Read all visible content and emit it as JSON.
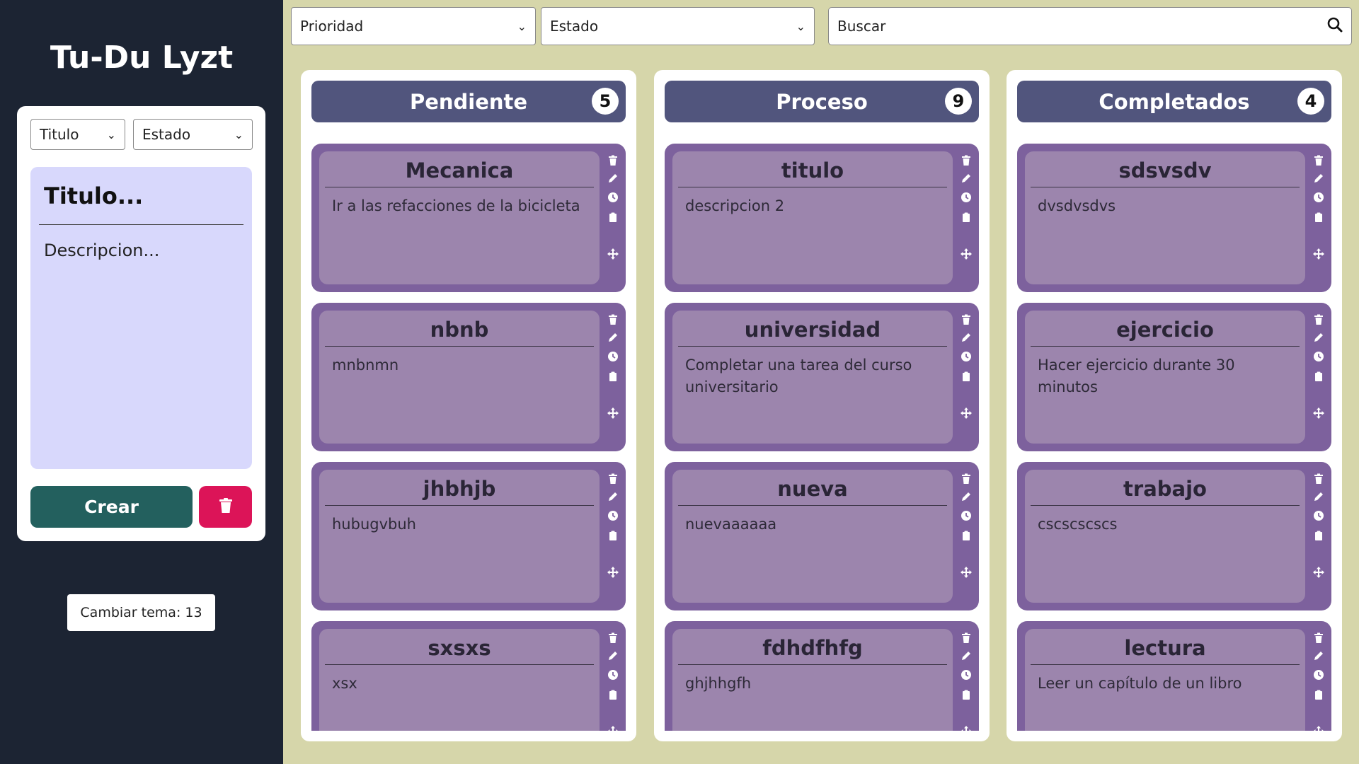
{
  "sidebar": {
    "app_title": "Tu-Du Lyzt",
    "create_form": {
      "title_select": "Titulo",
      "status_select": "Estado",
      "note_title_placeholder": "Titulo...",
      "note_desc_placeholder": "Descripcion...",
      "create_label": "Crear",
      "delete_icon": "trash-icon"
    },
    "theme_button": "Cambiar tema: 13"
  },
  "toolbar": {
    "priority_select": "Prioridad",
    "status_select": "Estado",
    "search_placeholder": "Buscar",
    "search_icon": "search-icon"
  },
  "card_action_icons": [
    "trash-icon",
    "pencil-icon",
    "clock-icon",
    "clipboard-icon",
    "move-icon"
  ],
  "colors": {
    "sidebar_bg": "#1c2433",
    "page_bg": "#d6d6aa",
    "column_header": "#51557d",
    "card_outer": "#7d619d",
    "card_inner": "#9c85ad",
    "create_button": "#23605e",
    "delete_button": "#dc1458",
    "note_bg": "#d8d8fc"
  },
  "columns": [
    {
      "title": "Pendiente",
      "count": "5",
      "cards": [
        {
          "title": "Mecanica",
          "description": "Ir a las refacciones de la bicicleta"
        },
        {
          "title": "nbnb",
          "description": "mnbnmn"
        },
        {
          "title": "jhbhjb",
          "description": "hubugvbuh"
        },
        {
          "title": "sxsxs",
          "description": "xsx"
        }
      ]
    },
    {
      "title": "Proceso",
      "count": "9",
      "cards": [
        {
          "title": "titulo",
          "description": "descripcion 2"
        },
        {
          "title": "universidad",
          "description": "Completar una tarea del curso universitario"
        },
        {
          "title": "nueva",
          "description": "nuevaaaaaa"
        },
        {
          "title": "fdhdfhfg",
          "description": "ghjhhgfh"
        }
      ]
    },
    {
      "title": "Completados",
      "count": "4",
      "cards": [
        {
          "title": "sdsvsdv",
          "description": "dvsdvsdvs"
        },
        {
          "title": "ejercicio",
          "description": "Hacer ejercicio durante 30 minutos"
        },
        {
          "title": "trabajo",
          "description": "cscscscscs"
        },
        {
          "title": "lectura",
          "description": "Leer un capítulo de un libro"
        }
      ]
    }
  ]
}
